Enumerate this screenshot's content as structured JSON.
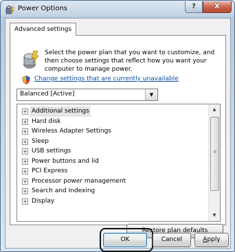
{
  "window": {
    "title": "Power Options",
    "help_label": "?",
    "close_label": "X"
  },
  "tab": {
    "label": "Advanced settings"
  },
  "description": "Select the power plan that you want to customize, and then choose settings that reflect how you want your computer to manage power.",
  "change_link": "Change settings that are currently unavailable",
  "plan_select": {
    "value": "Balanced [Active]"
  },
  "tree": {
    "items": [
      {
        "label": "Additional settings"
      },
      {
        "label": "Hard disk"
      },
      {
        "label": "Wireless Adapter Settings"
      },
      {
        "label": "Sleep"
      },
      {
        "label": "USB settings"
      },
      {
        "label": "Power buttons and lid"
      },
      {
        "label": "PCI Express"
      },
      {
        "label": "Processor power management"
      },
      {
        "label": "Search and Indexing"
      },
      {
        "label": "Display"
      }
    ]
  },
  "buttons": {
    "restore_prefix": "R",
    "restore_rest": "estore plan defaults",
    "ok": "OK",
    "cancel": "Cancel",
    "apply_prefix": "A",
    "apply_rest": "pply"
  }
}
